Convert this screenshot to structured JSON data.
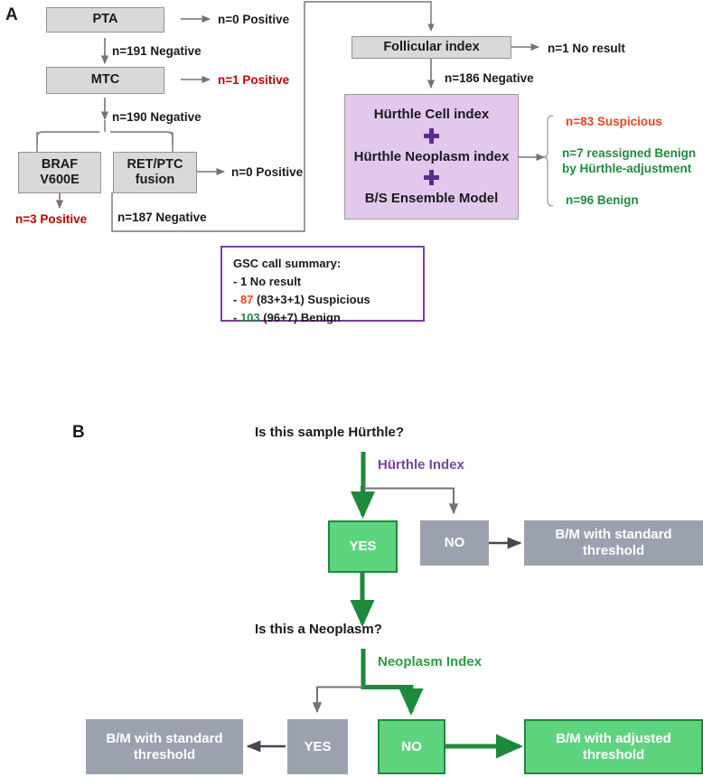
{
  "figure": {
    "panels": [
      {
        "id": "A",
        "label": "A"
      },
      {
        "id": "B",
        "label": "B"
      }
    ]
  },
  "colors": {
    "gray_box_fill": "#d9d9d9",
    "purple_box_fill": "#e3c8ee",
    "slate_box_fill": "#9ba1ae",
    "green_box_fill": "#5fd47f",
    "green_box_border": "#1d8a3b",
    "red_text": "#c00000",
    "orange_text": "#e8451c",
    "green_text": "#1e8c3c",
    "purple_text": "#7b3fa8",
    "summary_border": "#7a3fa0",
    "connector_gray": "#7b7070",
    "connector_green": "#1d8a3b",
    "plus_purple": "#5b2d8e"
  },
  "panelA": {
    "label": "A",
    "nodes": {
      "pta": "PTA",
      "mtc": "MTC",
      "braf_line1": "BRAF",
      "braf_line2": "V600E",
      "ret_line1": "RET/PTC",
      "ret_line2": "fusion",
      "follicular": "Follicular index",
      "hurthle_cell": "Hürthle Cell index",
      "hurthle_neoplasm": "Hürthle Neoplasm index",
      "bs_ensemble": "B/S Ensemble Model",
      "plus_glyph_1": "plus-icon",
      "plus_glyph_2": "plus-icon"
    },
    "edges": {
      "pta_positive": "n=0 Positive",
      "pta_negative": "n=191 Negative",
      "mtc_positive": "n=1 Positive",
      "mtc_negative": "n=190 Negative",
      "ret_positive": "n=0 Positive",
      "braf_positive": "n=3 Positive",
      "ret_negative": "n=187 Negative",
      "follicular_noresult": "n=1 No result",
      "follicular_negative": "n=186 Negative"
    },
    "outcomes": [
      {
        "text": "n=83 Suspicious",
        "color": "orange"
      },
      {
        "text": "n=7 reassigned Benign",
        "color": "green"
      },
      {
        "text": "by Hürthle-adjustment",
        "color": "green"
      },
      {
        "text": "n=96 Benign",
        "color": "green"
      }
    ],
    "summary": {
      "title": "GSC call summary:",
      "lines": [
        {
          "prefix": "- ",
          "num": "1",
          "num_color": "black",
          "rest": " No result"
        },
        {
          "prefix": "- ",
          "num": "87",
          "num_color": "orange",
          "rest": " (83+3+1) Suspicious"
        },
        {
          "prefix": "- ",
          "num": "103",
          "num_color": "green",
          "rest": " (96+7) Benign"
        }
      ]
    }
  },
  "panelB": {
    "label": "B",
    "question_1": "Is this sample Hürthle?",
    "index_label_1": "Hürthle Index",
    "question_2": "Is this a Neoplasm?",
    "index_label_2": "Neoplasm Index",
    "row1": {
      "yes": "YES",
      "no": "NO",
      "outcome": "B/M with standard threshold",
      "outcome_line1": "B/M with standard",
      "outcome_line2": "threshold"
    },
    "row2": {
      "outcome_left_line1": "B/M with standard",
      "outcome_left_line2": "threshold",
      "yes": "YES",
      "no": "NO",
      "outcome_right_line1": "B/M with adjusted",
      "outcome_right_line2": "threshold"
    }
  }
}
